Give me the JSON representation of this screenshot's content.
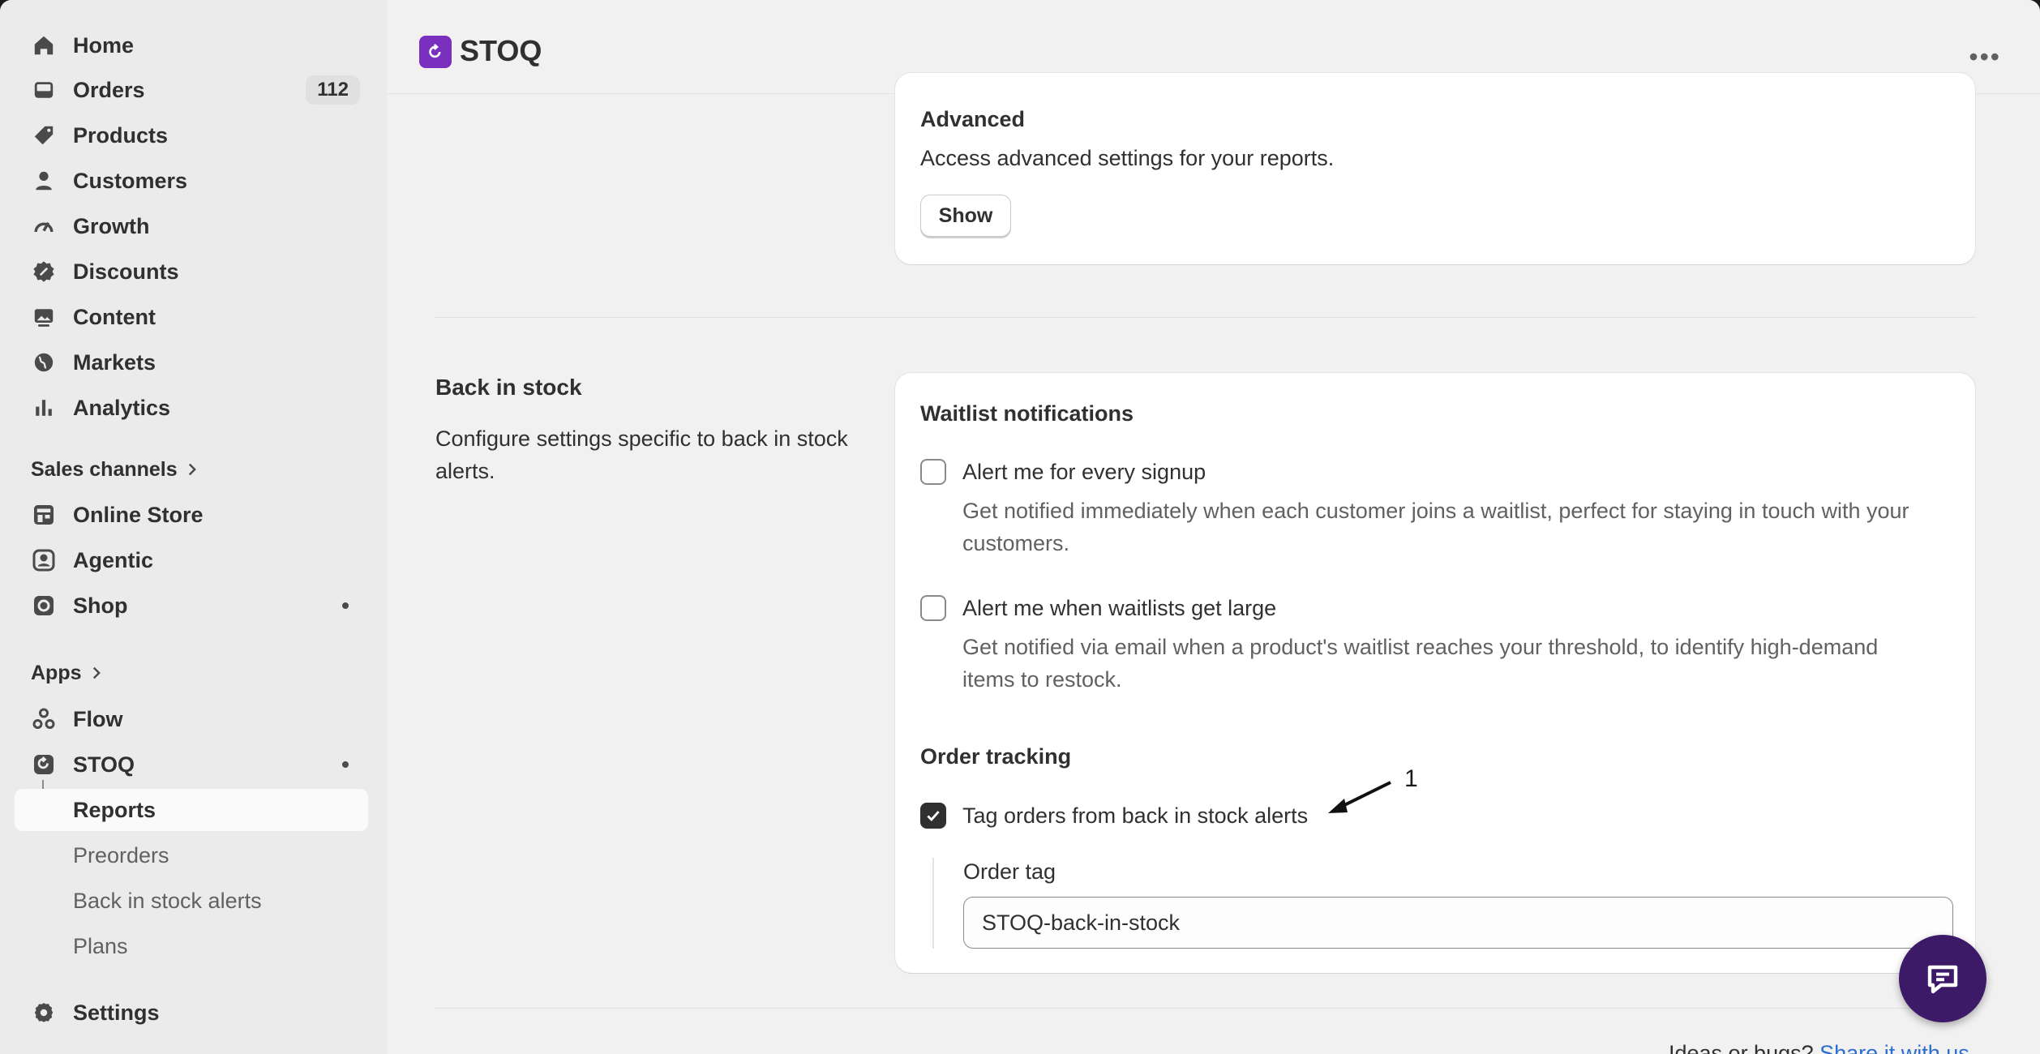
{
  "sidebar": {
    "main": [
      {
        "label": "Home",
        "icon": "home-icon"
      },
      {
        "label": "Orders",
        "icon": "inbox-icon",
        "badge": "112"
      },
      {
        "label": "Products",
        "icon": "tag-icon"
      },
      {
        "label": "Customers",
        "icon": "person-icon"
      },
      {
        "label": "Growth",
        "icon": "gauge-icon"
      },
      {
        "label": "Discounts",
        "icon": "discount-icon"
      },
      {
        "label": "Content",
        "icon": "image-icon"
      },
      {
        "label": "Markets",
        "icon": "globe-icon"
      },
      {
        "label": "Analytics",
        "icon": "bar-chart-icon"
      }
    ],
    "sales_channels_heading": "Sales channels",
    "sales_channels": [
      {
        "label": "Online Store",
        "icon": "store-icon"
      },
      {
        "label": "Agentic",
        "icon": "agentic-icon"
      },
      {
        "label": "Shop",
        "icon": "shop-icon"
      }
    ],
    "apps_heading": "Apps",
    "apps": [
      {
        "label": "Flow",
        "icon": "flow-icon"
      },
      {
        "label": "STOQ",
        "icon": "stoq-icon"
      }
    ],
    "stoq_sub": [
      "Reports",
      "Preorders",
      "Back in stock alerts",
      "Plans"
    ],
    "settings": {
      "label": "Settings",
      "icon": "gear-icon"
    }
  },
  "header": {
    "app_title": "STOQ",
    "more": "•••"
  },
  "advanced": {
    "title": "Advanced",
    "description": "Access advanced settings for your reports.",
    "show_button": "Show"
  },
  "back_in_stock": {
    "title": "Back in stock",
    "description": "Configure settings specific to back in stock alerts.",
    "waitlist_heading": "Waitlist notifications",
    "options": [
      {
        "label": "Alert me for every signup",
        "help": "Get notified immediately when each customer joins a waitlist, perfect for staying in touch with your customers.",
        "checked": false
      },
      {
        "label": "Alert me when waitlists get large",
        "help": "Get notified via email when a product's waitlist reaches your threshold, to identify high-demand items to restock.",
        "checked": false
      }
    ],
    "order_tracking_heading": "Order tracking",
    "tag_orders": {
      "label": "Tag orders from back in stock alerts",
      "checked": true
    },
    "order_tag_label": "Order tag",
    "order_tag_value": "STOQ-back-in-stock"
  },
  "annotation": {
    "number": "1"
  },
  "footer": {
    "text": "Ideas or bugs? ",
    "link": "Share it with us"
  },
  "colors": {
    "accent": "#7b2fbf",
    "chat_button": "#3d1a68",
    "link": "#2c6ecb"
  }
}
